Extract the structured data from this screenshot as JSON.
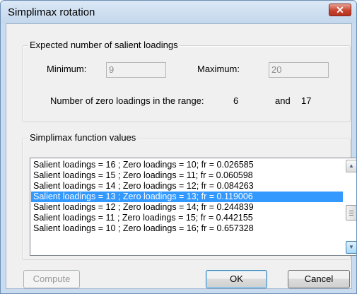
{
  "window": {
    "title": "Simplimax rotation",
    "close_glyph": "✕"
  },
  "expected_group": {
    "legend": "Expected number of salient loadings",
    "min_label": "Minimum:",
    "min_value": "9",
    "max_label": "Maximum:",
    "max_value": "20",
    "range_label": "Number of zero loadings in the range:",
    "range_low": "6",
    "range_and": "and",
    "range_high": "17"
  },
  "function_group": {
    "legend": "Simplimax function values",
    "rows": [
      "Salient loadings = 16 ; Zero loadings = 10; fr = 0.026585",
      "Salient loadings = 15 ; Zero loadings = 11; fr = 0.060598",
      "Salient loadings = 14 ; Zero loadings = 12; fr = 0.084263",
      "Salient loadings = 13 ; Zero loadings = 13; fr = 0.119006",
      "Salient loadings = 12 ; Zero loadings = 14; fr = 0.244839",
      "Salient loadings = 11 ; Zero loadings = 15; fr = 0.442155",
      "Salient loadings = 10 ; Zero loadings = 16; fr = 0.657328"
    ],
    "selected_index": 3
  },
  "buttons": {
    "compute": "Compute",
    "ok": "OK",
    "cancel": "Cancel"
  },
  "colors": {
    "selection": "#3399ff",
    "dialog_bg": "#f0f0f0",
    "close": "#c8432e"
  }
}
